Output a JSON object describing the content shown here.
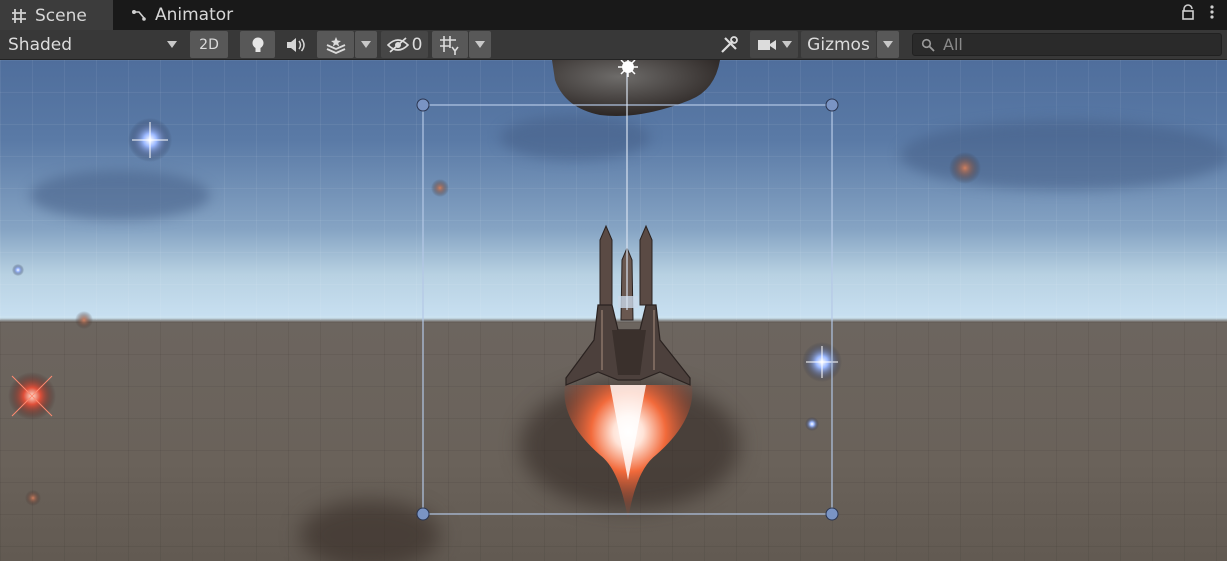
{
  "tabs": [
    {
      "label": "Scene",
      "icon": "grid-icon",
      "active": true
    },
    {
      "label": "Animator",
      "icon": "animator-icon",
      "active": false
    }
  ],
  "toolbar": {
    "draw_mode": "Shaded",
    "mode_2d_label": "2D",
    "hidden_objects_count": "0",
    "gizmos_label": "Gizmos"
  },
  "search": {
    "placeholder": "All"
  },
  "colors": {
    "panel_bg": "#383838",
    "tab_bar_bg": "#191919",
    "button_bg": "#585858",
    "selection_outline": "#b4c8e6",
    "engine_glow": "#f26a3b"
  }
}
